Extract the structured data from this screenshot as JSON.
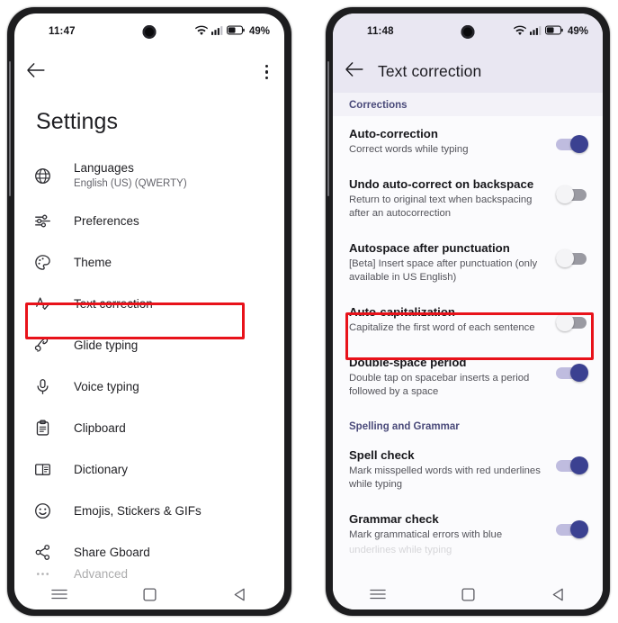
{
  "left_phone": {
    "status_bar": {
      "time": "11:47",
      "wifi_icon": "wifi-icon",
      "signal_icon": "cellular-signal-icon",
      "battery_icon": "battery-icon",
      "battery_text": "49%"
    },
    "app_bar": {
      "back_icon": "back-arrow-icon",
      "overflow_icon": "kebab-menu-icon"
    },
    "page_title": "Settings",
    "items": [
      {
        "label": "Languages",
        "sublabel": "English (US) (QWERTY)",
        "icon": "globe-icon",
        "highlighted": false
      },
      {
        "label": "Preferences",
        "sublabel": "",
        "icon": "tune-sliders-icon",
        "highlighted": false
      },
      {
        "label": "Theme",
        "sublabel": "",
        "icon": "palette-icon",
        "highlighted": false
      },
      {
        "label": "Text correction",
        "sublabel": "",
        "icon": "a-check-icon",
        "highlighted": true
      },
      {
        "label": "Glide typing",
        "sublabel": "",
        "icon": "glide-swipe-icon",
        "highlighted": false
      },
      {
        "label": "Voice typing",
        "sublabel": "",
        "icon": "microphone-icon",
        "highlighted": false
      },
      {
        "label": "Clipboard",
        "sublabel": "",
        "icon": "clipboard-icon",
        "highlighted": false
      },
      {
        "label": "Dictionary",
        "sublabel": "",
        "icon": "book-icon",
        "highlighted": false
      },
      {
        "label": "Emojis, Stickers & GIFs",
        "sublabel": "",
        "icon": "smiley-icon",
        "highlighted": false
      },
      {
        "label": "Share Gboard",
        "sublabel": "",
        "icon": "share-icon",
        "highlighted": false
      }
    ],
    "advanced_item": {
      "label": "Advanced",
      "icon": "more-horizontal-icon"
    },
    "nav_bar": {
      "recents_icon": "recents-menu-icon",
      "home_icon": "home-square-icon",
      "back_icon": "back-triangle-icon"
    }
  },
  "right_phone": {
    "status_bar": {
      "time": "11:48",
      "wifi_icon": "wifi-icon",
      "signal_icon": "cellular-signal-icon",
      "battery_icon": "battery-icon",
      "battery_text": "49%"
    },
    "app_bar": {
      "back_icon": "back-arrow-icon",
      "title": "Text correction"
    },
    "sections": [
      {
        "header": "Corrections",
        "prefs": [
          {
            "title": "Auto-correction",
            "sub": "Correct words while typing",
            "toggle": "on",
            "highlighted": false
          },
          {
            "title": "Undo auto-correct on backspace",
            "sub": "Return to original text when backspacing after an autocorrection",
            "toggle": "off",
            "highlighted": false
          },
          {
            "title": "Autospace after punctuation",
            "sub": "[Beta] Insert space after punctuation (only available in US English)",
            "toggle": "off",
            "highlighted": false
          },
          {
            "title": "Auto-capitalization",
            "sub": "Capitalize the first word of each sentence",
            "toggle": "off",
            "highlighted": true
          },
          {
            "title": "Double-space period",
            "sub": "Double tap on spacebar inserts a period followed by a space",
            "toggle": "on",
            "highlighted": false
          }
        ]
      },
      {
        "header": "Spelling and Grammar",
        "prefs": [
          {
            "title": "Spell check",
            "sub": "Mark misspelled words with red underlines while typing",
            "toggle": "on",
            "highlighted": false
          },
          {
            "title": "Grammar check",
            "sub": "Mark grammatical errors with blue",
            "sub2": "underlines while typing",
            "toggle": "on",
            "highlighted": false
          }
        ]
      }
    ],
    "nav_bar": {
      "recents_icon": "recents-menu-icon",
      "home_icon": "home-square-icon",
      "back_icon": "back-triangle-icon"
    }
  },
  "colors": {
    "highlight_box": "#e8121a",
    "toggle_on": "#3b4191",
    "toggle_on_track": "#bfbcdf",
    "toggle_off_track": "#9a9aa2",
    "app_bar_tint": "#e9e7f2",
    "section_header_text": "#4a4a7a"
  }
}
